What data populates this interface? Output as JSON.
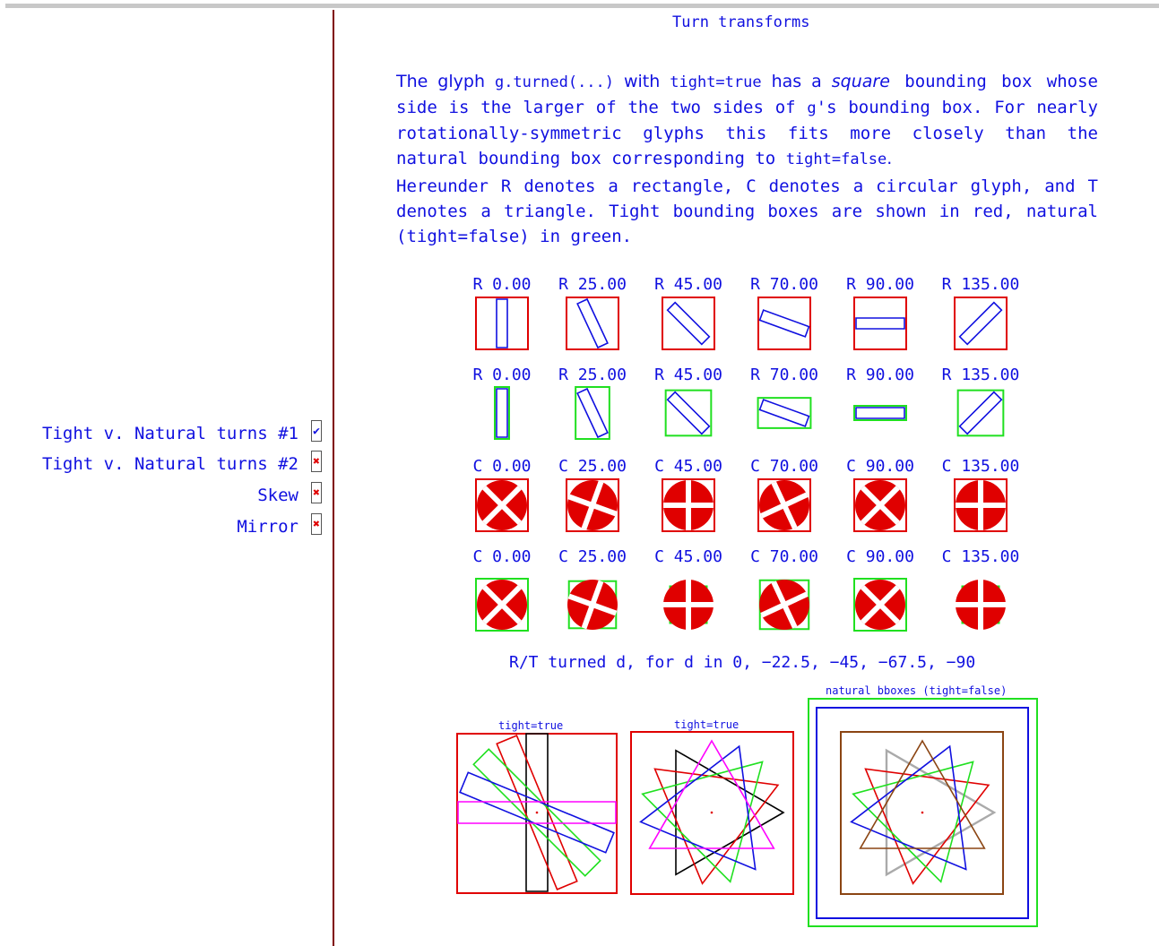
{
  "sidebar": {
    "items": [
      {
        "label": "Tight v. Natural turns #1",
        "checked": true,
        "mark": "✔"
      },
      {
        "label": "Tight v. Natural turns #2",
        "checked": false,
        "mark": "✖"
      },
      {
        "label": "Skew",
        "checked": false,
        "mark": "✖"
      },
      {
        "label": "Mirror",
        "checked": false,
        "mark": "✖"
      }
    ]
  },
  "main": {
    "title": "Turn transforms",
    "para1": {
      "t1": "The glyph ",
      "c1": "g.turned(...)",
      "t2": " with ",
      "c2": "tight=true",
      "t3": " has a ",
      "i1": "square",
      "t4": " bounding box whose side is the larger of the two sides of ",
      "c3": "g",
      "t5": "'s bounding box. For nearly rotationally-symmetric glyphs this fits more closely than the natural bounding box corresponding to ",
      "c4": "tight=false",
      "t6": "."
    },
    "para2": "Hereunder R denotes a rectangle, C denotes a circular glyph, and T denotes a triangle. Tight bounding boxes are shown in red, natural (tight=false) in green.",
    "rows": [
      {
        "shape": "R",
        "box": "tight",
        "labels": [
          "R 0.00",
          "R 25.00",
          "R 45.00",
          "R 70.00",
          "R 90.00",
          "R 135.00"
        ]
      },
      {
        "shape": "R",
        "box": "natural",
        "labels": [
          "R 0.00",
          "R 25.00",
          "R 45.00",
          "R 70.00",
          "R 90.00",
          "R 135.00"
        ]
      },
      {
        "shape": "C",
        "box": "tight",
        "labels": [
          "C 0.00",
          "C 25.00",
          "C 45.00",
          "C 70.00",
          "C 90.00",
          "C 135.00"
        ]
      },
      {
        "shape": "C",
        "box": "natural",
        "labels": [
          "C 0.00",
          "C 25.00",
          "C 45.00",
          "C 70.00",
          "C 90.00",
          "C 135.00"
        ]
      }
    ],
    "angles": [
      0,
      25,
      45,
      70,
      90,
      135
    ],
    "rt_caption": "R/T turned d, for d in 0, −22.5, −45, −67.5, −90",
    "panels": [
      {
        "caption": "tight=true"
      },
      {
        "caption": "tight=true"
      },
      {
        "caption": "natural bboxes (tight=false)"
      }
    ],
    "turn_angles": [
      0,
      -22.5,
      -45,
      -67.5,
      -90
    ],
    "colors": {
      "text": "#1010e0",
      "tight": "#e00000",
      "natural": "#20e020",
      "divider": "#800000",
      "series": [
        "#000000",
        "#e00000",
        "#20e020",
        "#1010e0",
        "#ff00ff"
      ]
    }
  }
}
